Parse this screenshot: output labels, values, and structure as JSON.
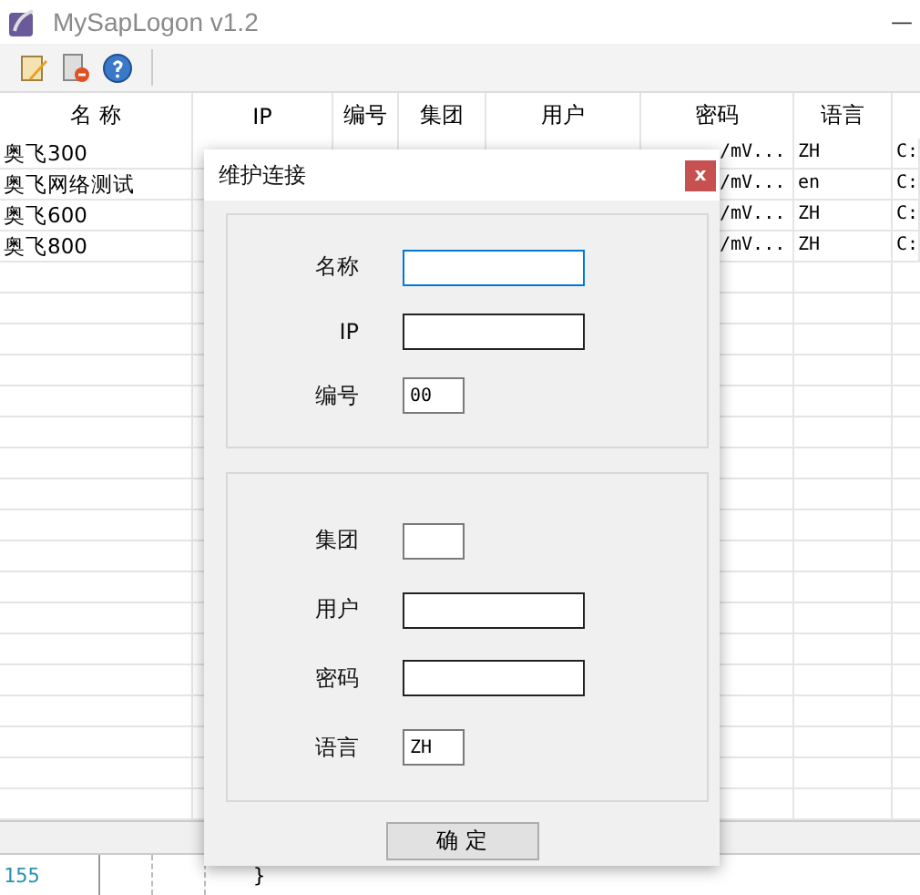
{
  "window": {
    "title": "MySapLogon v1.2",
    "minimize": "—"
  },
  "table": {
    "columns": [
      "名 称",
      "IP",
      "编号",
      "集团",
      "用户",
      "密码",
      "语言"
    ],
    "rows": [
      {
        "name": "奥飞300",
        "password": "/mV...",
        "language": "ZH",
        "path": "C:"
      },
      {
        "name": "奥飞网络测试",
        "password": "/mV...",
        "language": "en",
        "path": "C:"
      },
      {
        "name": "奥飞600",
        "password": "/mV...",
        "language": "ZH",
        "path": "C:"
      },
      {
        "name": "奥飞800",
        "password": "/mV...",
        "language": "ZH",
        "path": "C:"
      }
    ]
  },
  "editor": {
    "line_number": "155",
    "code": "}"
  },
  "dialog": {
    "title": "维护连接",
    "close": "x",
    "groups": [
      {
        "fields": [
          {
            "label": "名称",
            "kind": "wide",
            "focused": true
          },
          {
            "label": "IP",
            "kind": "wide",
            "focused": false
          },
          {
            "label": "编号",
            "kind": "short",
            "focused": false,
            "value": "00"
          }
        ]
      },
      {
        "fields": [
          {
            "label": "集团",
            "kind": "short",
            "focused": false
          },
          {
            "label": "用户",
            "kind": "wide",
            "focused": false
          },
          {
            "label": "密码",
            "kind": "wide",
            "focused": false
          },
          {
            "label": "语言",
            "kind": "short",
            "focused": false,
            "value": "ZH"
          }
        ]
      }
    ],
    "ok_button": "确 定"
  }
}
